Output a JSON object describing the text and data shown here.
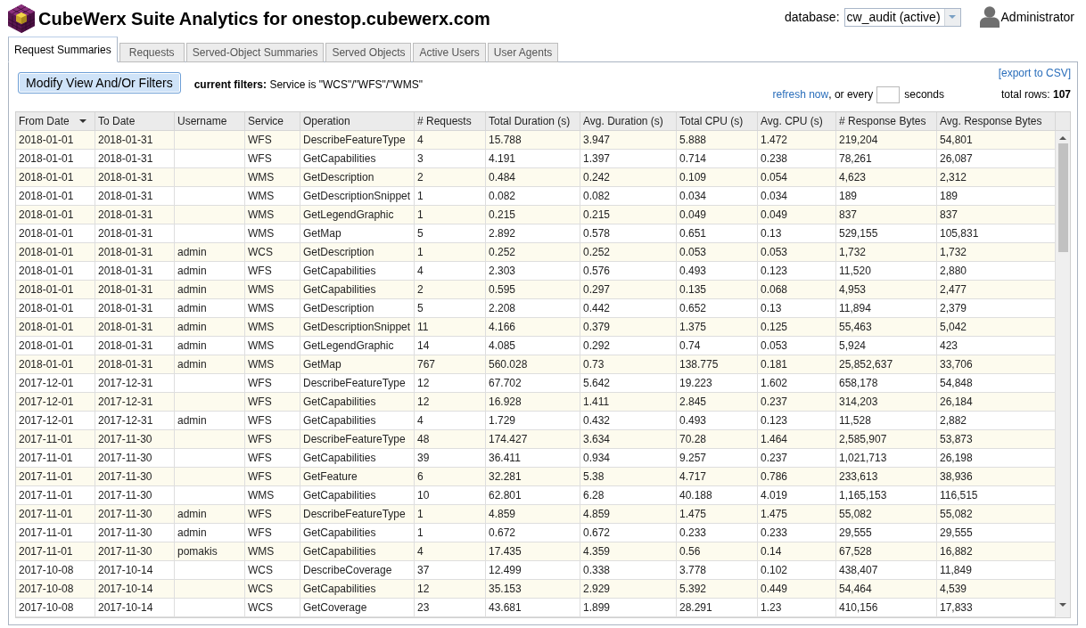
{
  "header": {
    "title": "CubeWerx Suite Analytics for onestop.cubewerx.com",
    "database_label": "database:",
    "database_value": "cw_audit (active)",
    "user": "Administrator"
  },
  "tabs": [
    {
      "label": "Request Summaries",
      "selected": true
    },
    {
      "label": "Requests",
      "selected": false
    },
    {
      "label": "Served-Object Summaries",
      "selected": false
    },
    {
      "label": "Served Objects",
      "selected": false
    },
    {
      "label": "Active Users",
      "selected": false
    },
    {
      "label": "User Agents",
      "selected": false
    }
  ],
  "toolbar": {
    "modify_button": "Modify View And/Or Filters",
    "filters": "**current filters:** Service is \"WCS\"/\"WFS\"/\"WMS\"",
    "export_link": "[export to CSV]",
    "refresh_link": "refresh now",
    "refresh_text": ", or every",
    "seconds_label": "seconds",
    "total_rows": "total rows: **107**"
  },
  "table": {
    "columns": [
      {
        "label": "From Date",
        "sorted": true
      },
      {
        "label": "To Date",
        "sorted": false
      },
      {
        "label": "Username",
        "sorted": false
      },
      {
        "label": "Service",
        "sorted": false
      },
      {
        "label": "Operation",
        "sorted": false
      },
      {
        "label": "# Requests",
        "sorted": false
      },
      {
        "label": "Total Duration (s)",
        "sorted": false
      },
      {
        "label": "Avg. Duration (s)",
        "sorted": false
      },
      {
        "label": "Total CPU (s)",
        "sorted": false
      },
      {
        "label": "Avg. CPU (s)",
        "sorted": false
      },
      {
        "label": "# Response Bytes",
        "sorted": false
      },
      {
        "label": "Avg. Response Bytes",
        "sorted": false
      }
    ],
    "rows": [
      {
        "from_date": "2018-01-01",
        "to_date": "2018-01-31",
        "service": "WFS",
        "operation": "DescribeFeatureType",
        "requests": "4",
        "total_duration": "15.788",
        "avg_duration": "3.947",
        "total_cpu": "5.888",
        "avg_cpu": "1.472",
        "response_bytes": "219,204",
        "avg_response_bytes": "54,801"
      },
      {
        "from_date": "2018-01-01",
        "to_date": "2018-01-31",
        "service": "WFS",
        "operation": "GetCapabilities",
        "requests": "3",
        "total_duration": "4.191",
        "avg_duration": "1.397",
        "total_cpu": "0.714",
        "avg_cpu": "0.238",
        "response_bytes": "78,261",
        "avg_response_bytes": "26,087"
      },
      {
        "from_date": "2018-01-01",
        "to_date": "2018-01-31",
        "service": "WMS",
        "operation": "GetDescription",
        "requests": "2",
        "total_duration": "0.484",
        "avg_duration": "0.242",
        "total_cpu": "0.109",
        "avg_cpu": "0.054",
        "response_bytes": "4,623",
        "avg_response_bytes": "2,312"
      },
      {
        "from_date": "2018-01-01",
        "to_date": "2018-01-31",
        "service": "WMS",
        "operation": "GetDescriptionSnippet",
        "requests": "1",
        "total_duration": "0.082",
        "avg_duration": "0.082",
        "total_cpu": "0.034",
        "avg_cpu": "0.034",
        "response_bytes": "189",
        "avg_response_bytes": "189"
      },
      {
        "from_date": "2018-01-01",
        "to_date": "2018-01-31",
        "service": "WMS",
        "operation": "GetLegendGraphic",
        "requests": "1",
        "total_duration": "0.215",
        "avg_duration": "0.215",
        "total_cpu": "0.049",
        "avg_cpu": "0.049",
        "response_bytes": "837",
        "avg_response_bytes": "837"
      },
      {
        "from_date": "2018-01-01",
        "to_date": "2018-01-31",
        "service": "WMS",
        "operation": "GetMap",
        "requests": "5",
        "total_duration": "2.892",
        "avg_duration": "0.578",
        "total_cpu": "0.651",
        "avg_cpu": "0.13",
        "response_bytes": "529,155",
        "avg_response_bytes": "105,831"
      },
      {
        "from_date": "2018-01-01",
        "to_date": "2018-01-31",
        "username": "admin",
        "service": "WCS",
        "operation": "GetDescription",
        "requests": "1",
        "total_duration": "0.252",
        "avg_duration": "0.252",
        "total_cpu": "0.053",
        "avg_cpu": "0.053",
        "response_bytes": "1,732",
        "avg_response_bytes": "1,732"
      },
      {
        "from_date": "2018-01-01",
        "to_date": "2018-01-31",
        "username": "admin",
        "service": "WFS",
        "operation": "GetCapabilities",
        "requests": "4",
        "total_duration": "2.303",
        "avg_duration": "0.576",
        "total_cpu": "0.493",
        "avg_cpu": "0.123",
        "response_bytes": "11,520",
        "avg_response_bytes": "2,880"
      },
      {
        "from_date": "2018-01-01",
        "to_date": "2018-01-31",
        "username": "admin",
        "service": "WMS",
        "operation": "GetCapabilities",
        "requests": "2",
        "total_duration": "0.595",
        "avg_duration": "0.297",
        "total_cpu": "0.135",
        "avg_cpu": "0.068",
        "response_bytes": "4,953",
        "avg_response_bytes": "2,477"
      },
      {
        "from_date": "2018-01-01",
        "to_date": "2018-01-31",
        "username": "admin",
        "service": "WMS",
        "operation": "GetDescription",
        "requests": "5",
        "total_duration": "2.208",
        "avg_duration": "0.442",
        "total_cpu": "0.652",
        "avg_cpu": "0.13",
        "response_bytes": "11,894",
        "avg_response_bytes": "2,379"
      },
      {
        "from_date": "2018-01-01",
        "to_date": "2018-01-31",
        "username": "admin",
        "service": "WMS",
        "operation": "GetDescriptionSnippet",
        "requests": "11",
        "total_duration": "4.166",
        "avg_duration": "0.379",
        "total_cpu": "1.375",
        "avg_cpu": "0.125",
        "response_bytes": "55,463",
        "avg_response_bytes": "5,042"
      },
      {
        "from_date": "2018-01-01",
        "to_date": "2018-01-31",
        "username": "admin",
        "service": "WMS",
        "operation": "GetLegendGraphic",
        "requests": "14",
        "total_duration": "4.085",
        "avg_duration": "0.292",
        "total_cpu": "0.74",
        "avg_cpu": "0.053",
        "response_bytes": "5,924",
        "avg_response_bytes": "423"
      },
      {
        "from_date": "2018-01-01",
        "to_date": "2018-01-31",
        "username": "admin",
        "service": "WMS",
        "operation": "GetMap",
        "requests": "767",
        "total_duration": "560.028",
        "avg_duration": "0.73",
        "total_cpu": "138.775",
        "avg_cpu": "0.181",
        "response_bytes": "25,852,637",
        "avg_response_bytes": "33,706"
      },
      {
        "from_date": "2017-12-01",
        "to_date": "2017-12-31",
        "service": "WFS",
        "operation": "DescribeFeatureType",
        "requests": "12",
        "total_duration": "67.702",
        "avg_duration": "5.642",
        "total_cpu": "19.223",
        "avg_cpu": "1.602",
        "response_bytes": "658,178",
        "avg_response_bytes": "54,848"
      },
      {
        "from_date": "2017-12-01",
        "to_date": "2017-12-31",
        "service": "WFS",
        "operation": "GetCapabilities",
        "requests": "12",
        "total_duration": "16.928",
        "avg_duration": "1.411",
        "total_cpu": "2.845",
        "avg_cpu": "0.237",
        "response_bytes": "314,203",
        "avg_response_bytes": "26,184"
      },
      {
        "from_date": "2017-12-01",
        "to_date": "2017-12-31",
        "username": "admin",
        "service": "WFS",
        "operation": "GetCapabilities",
        "requests": "4",
        "total_duration": "1.729",
        "avg_duration": "0.432",
        "total_cpu": "0.493",
        "avg_cpu": "0.123",
        "response_bytes": "11,528",
        "avg_response_bytes": "2,882"
      },
      {
        "from_date": "2017-11-01",
        "to_date": "2017-11-30",
        "service": "WFS",
        "operation": "DescribeFeatureType",
        "requests": "48",
        "total_duration": "174.427",
        "avg_duration": "3.634",
        "total_cpu": "70.28",
        "avg_cpu": "1.464",
        "response_bytes": "2,585,907",
        "avg_response_bytes": "53,873"
      },
      {
        "from_date": "2017-11-01",
        "to_date": "2017-11-30",
        "service": "WFS",
        "operation": "GetCapabilities",
        "requests": "39",
        "total_duration": "36.411",
        "avg_duration": "0.934",
        "total_cpu": "9.257",
        "avg_cpu": "0.237",
        "response_bytes": "1,021,713",
        "avg_response_bytes": "26,198"
      },
      {
        "from_date": "2017-11-01",
        "to_date": "2017-11-30",
        "service": "WFS",
        "operation": "GetFeature",
        "requests": "6",
        "total_duration": "32.281",
        "avg_duration": "5.38",
        "total_cpu": "4.717",
        "avg_cpu": "0.786",
        "response_bytes": "233,613",
        "avg_response_bytes": "38,936"
      },
      {
        "from_date": "2017-11-01",
        "to_date": "2017-11-30",
        "service": "WMS",
        "operation": "GetCapabilities",
        "requests": "10",
        "total_duration": "62.801",
        "avg_duration": "6.28",
        "total_cpu": "40.188",
        "avg_cpu": "4.019",
        "response_bytes": "1,165,153",
        "avg_response_bytes": "116,515"
      },
      {
        "from_date": "2017-11-01",
        "to_date": "2017-11-30",
        "username": "admin",
        "service": "WFS",
        "operation": "DescribeFeatureType",
        "requests": "1",
        "total_duration": "4.859",
        "avg_duration": "4.859",
        "total_cpu": "1.475",
        "avg_cpu": "1.475",
        "response_bytes": "55,082",
        "avg_response_bytes": "55,082"
      },
      {
        "from_date": "2017-11-01",
        "to_date": "2017-11-30",
        "username": "admin",
        "service": "WFS",
        "operation": "GetCapabilities",
        "requests": "1",
        "total_duration": "0.672",
        "avg_duration": "0.672",
        "total_cpu": "0.233",
        "avg_cpu": "0.233",
        "response_bytes": "29,555",
        "avg_response_bytes": "29,555"
      },
      {
        "from_date": "2017-11-01",
        "to_date": "2017-11-30",
        "username": "pomakis",
        "service": "WMS",
        "operation": "GetCapabilities",
        "requests": "4",
        "total_duration": "17.435",
        "avg_duration": "4.359",
        "total_cpu": "0.56",
        "avg_cpu": "0.14",
        "response_bytes": "67,528",
        "avg_response_bytes": "16,882"
      },
      {
        "from_date": "2017-10-08",
        "to_date": "2017-10-14",
        "service": "WCS",
        "operation": "DescribeCoverage",
        "requests": "37",
        "total_duration": "12.499",
        "avg_duration": "0.338",
        "total_cpu": "3.778",
        "avg_cpu": "0.102",
        "response_bytes": "438,407",
        "avg_response_bytes": "11,849"
      },
      {
        "from_date": "2017-10-08",
        "to_date": "2017-10-14",
        "service": "WCS",
        "operation": "GetCapabilities",
        "requests": "12",
        "total_duration": "35.153",
        "avg_duration": "2.929",
        "total_cpu": "5.392",
        "avg_cpu": "0.449",
        "response_bytes": "54,464",
        "avg_response_bytes": "4,539"
      },
      {
        "from_date": "2017-10-08",
        "to_date": "2017-10-14",
        "service": "WCS",
        "operation": "GetCoverage",
        "requests": "23",
        "total_duration": "43.681",
        "avg_duration": "1.899",
        "total_cpu": "28.291",
        "avg_cpu": "1.23",
        "response_bytes": "410,156",
        "avg_response_bytes": "17,833"
      }
    ]
  }
}
